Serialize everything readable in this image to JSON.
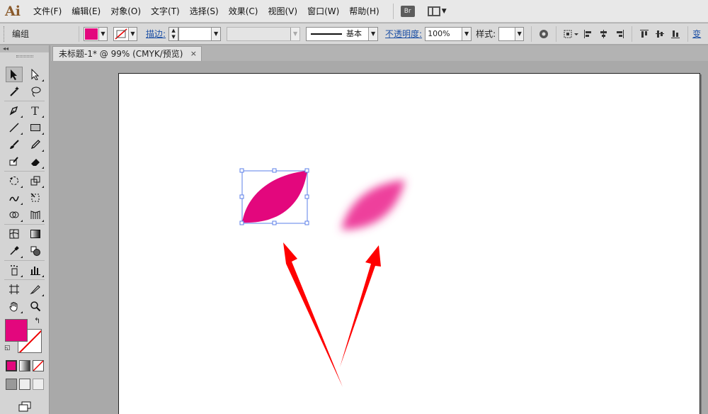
{
  "app": {
    "logo": "Ai"
  },
  "menu": {
    "items": [
      "文件(F)",
      "编辑(E)",
      "对象(O)",
      "文字(T)",
      "选择(S)",
      "效果(C)",
      "视图(V)",
      "窗口(W)",
      "帮助(H)"
    ],
    "bridge_badge": "Br"
  },
  "control_bar": {
    "selection_label": "编组",
    "fill_color": "#e3077d",
    "stroke_label": "描边:",
    "stroke_profile": "基本",
    "opacity_label": "不透明度:",
    "opacity_value": "100%",
    "style_label": "样式:",
    "more_label": "变"
  },
  "document": {
    "tab_title": "未标题-1* @ 99% (CMYK/预览)",
    "close_glyph": "×"
  },
  "toolbox": {
    "collapse_glyph": "◂◂",
    "fill_color": "#e3077d"
  },
  "colors": {
    "accent_fill": "#e3077d",
    "blurred_fill": "#ee409c",
    "selection": "#5b7fe8",
    "arrow": "#ff0000"
  }
}
